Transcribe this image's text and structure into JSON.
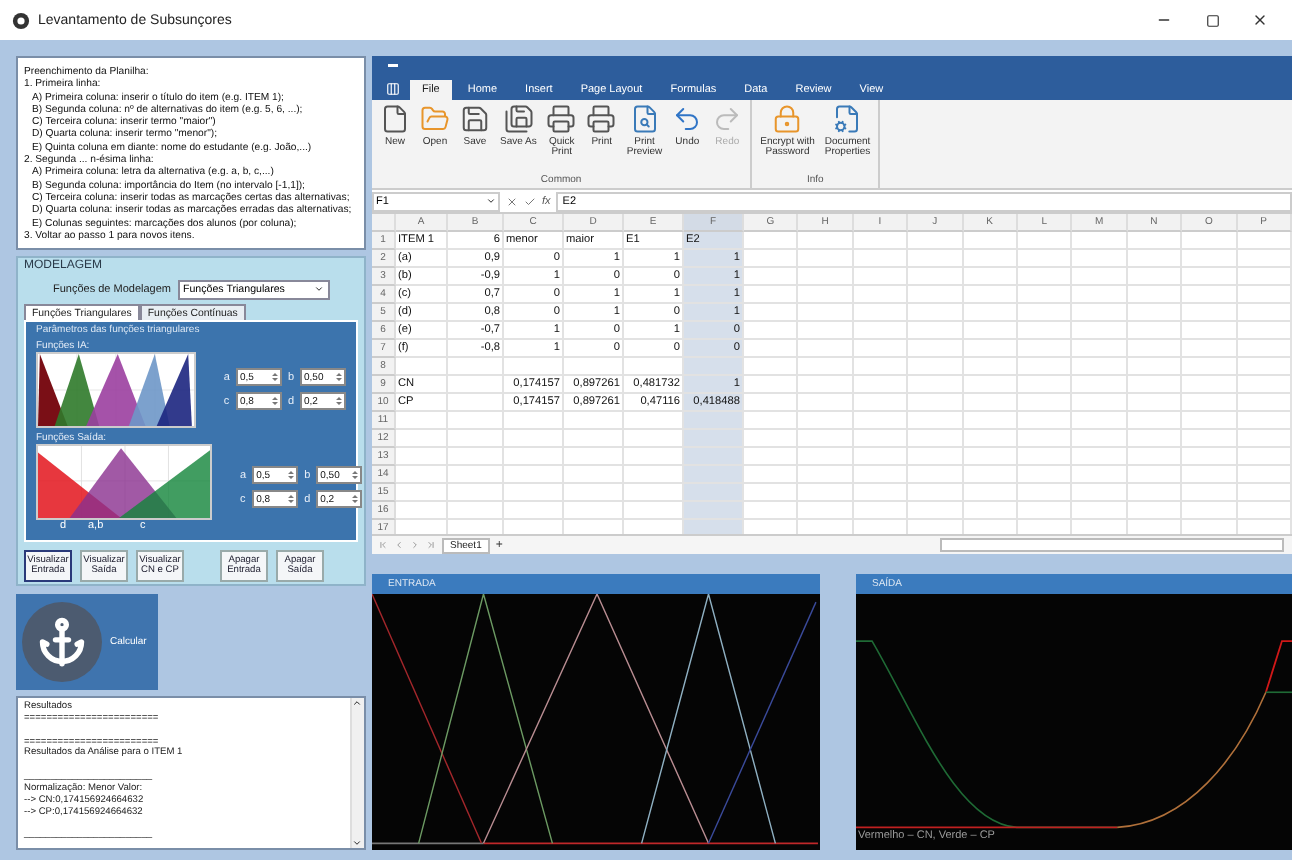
{
  "window": {
    "title": "Levantamento de Subsunçores"
  },
  "instructions": {
    "heading": "Preenchimento da Planilha:",
    "steps": [
      {
        "text": "1. Primeira linha:",
        "children": [
          {
            "text": "A) Primeira coluna: inserir o título do item (e.g. ITEM 1);"
          },
          {
            "text": "B) Segunda coluna: nº de alternativas do item (e.g. 5, 6, ...);"
          },
          {
            "text": "C) Terceira coluna: inserir termo \"maior\")"
          },
          {
            "text": "D) Quarta coluna: inserir termo \"menor\");"
          },
          {
            "text": "E) Quinta coluna em diante: nome do estudante (e.g. João,...)"
          }
        ]
      },
      {
        "text": "2. Segunda ... n-ésima linha:",
        "children": [
          {
            "text": "A) Primeira coluna: letra da alternativa (e.g. a, b, c,...)"
          },
          {
            "text": "B) Segunda coluna: importância do Item (no intervalo [-1,1]);"
          },
          {
            "text": "C) Terceira coluna: inserir todas as marcações certas das alternativas;"
          },
          {
            "text": "D) Quarta coluna: inserir todas as marcações erradas das alternativas;"
          },
          {
            "text": "E) Colunas seguintes: marcações dos alunos (por coluna);"
          }
        ]
      },
      {
        "text": "3. Voltar ao passo 1 para novos itens."
      }
    ]
  },
  "modelagem": {
    "title": "MODELAGEM",
    "function_label": "Funções de Modelagem",
    "function_value": "Funções Triangulares",
    "tabs": [
      {
        "label": "Funções Triangulares",
        "selected": true
      },
      {
        "label": "Funções Contínuas",
        "selected": false
      }
    ],
    "group_title": "Parâmetros das funções triangulares",
    "input_chart": {
      "title": "Funções IA:"
    },
    "input_params": [
      {
        "name": "a",
        "value": "0,5"
      },
      {
        "name": "b",
        "value": "0,50"
      },
      {
        "name": "c",
        "value": "0,8"
      },
      {
        "name": "d",
        "value": "0,2"
      }
    ],
    "output_chart": {
      "title": "Funções Saída:",
      "labels": [
        "d",
        "a,b",
        "c"
      ]
    },
    "output_params": [
      {
        "name": "a",
        "value": "0,5"
      },
      {
        "name": "b",
        "value": "0,50"
      },
      {
        "name": "c",
        "value": "0,8"
      },
      {
        "name": "d",
        "value": "0,2"
      }
    ],
    "buttons": [
      {
        "label": "Visualizar\nEntrada",
        "selected": true
      },
      {
        "label": "Visualizar\nSaída",
        "selected": false
      },
      {
        "label": "Visualizar\nCN e CP",
        "selected": false
      },
      {
        "label": "Apagar\nEntrada",
        "selected": false
      },
      {
        "label": "Apagar\nSaída",
        "selected": false
      }
    ]
  },
  "calculate_button": {
    "label": "Calcular"
  },
  "results": {
    "lines": [
      {
        "text": "Resultados",
        "space_before": false
      },
      {
        "text": "========================",
        "space_before": false
      },
      {
        "text": "========================",
        "space_before": true
      },
      {
        "text": "Resultados da Análise para o ITEM 1",
        "space_before": false
      },
      {
        "text": "________________________",
        "space_before": true
      },
      {
        "text": "Normalização: Menor Valor:",
        "space_before": false
      },
      {
        "text": "--> CN:0,174156924664632",
        "space_before": false
      },
      {
        "text": "--> CP:0,174156924664632",
        "space_before": false
      },
      {
        "text": "________________________",
        "space_before": true
      }
    ]
  },
  "ribbon": {
    "tabs": [
      {
        "label": "File",
        "selected": true
      },
      {
        "label": "Home",
        "selected": false
      },
      {
        "label": "Insert",
        "selected": false
      },
      {
        "label": "Page Layout",
        "selected": false
      },
      {
        "label": "Formulas",
        "selected": false
      },
      {
        "label": "Data",
        "selected": false
      },
      {
        "label": "Review",
        "selected": false
      },
      {
        "label": "View",
        "selected": false
      }
    ],
    "groups": [
      {
        "label": "Common",
        "buttons": [
          {
            "label": "New",
            "kind": "new",
            "disabled": false
          },
          {
            "label": "Open",
            "kind": "open",
            "disabled": false
          },
          {
            "label": "Save",
            "kind": "save",
            "disabled": false
          },
          {
            "label": "Save As",
            "kind": "saveas",
            "disabled": false
          },
          {
            "label": "Quick\nPrint",
            "kind": "print",
            "disabled": false
          },
          {
            "label": "Print",
            "kind": "print",
            "disabled": false
          },
          {
            "label": "Print\nPreview",
            "kind": "preview",
            "disabled": false
          },
          {
            "label": "Undo",
            "kind": "undo",
            "disabled": false
          },
          {
            "label": "Redo",
            "kind": "redo",
            "disabled": true
          }
        ]
      },
      {
        "label": "Info",
        "buttons": [
          {
            "label": "Encrypt with\nPassword",
            "kind": "lock",
            "disabled": false
          },
          {
            "label": "Document\nProperties",
            "kind": "properties",
            "disabled": false
          }
        ]
      }
    ]
  },
  "formula_bar": {
    "cell": "F1",
    "function_label": "fx",
    "value": "E2"
  },
  "sheet": {
    "columns": [
      {
        "label": "A",
        "selected": false
      },
      {
        "label": "B",
        "selected": false
      },
      {
        "label": "C",
        "selected": false
      },
      {
        "label": "D",
        "selected": false
      },
      {
        "label": "E",
        "selected": false
      },
      {
        "label": "F",
        "selected": true
      },
      {
        "label": "G",
        "selected": false
      },
      {
        "label": "H",
        "selected": false
      },
      {
        "label": "I",
        "selected": false
      },
      {
        "label": "J",
        "selected": false
      },
      {
        "label": "K",
        "selected": false
      },
      {
        "label": "L",
        "selected": false
      },
      {
        "label": "M",
        "selected": false
      },
      {
        "label": "N",
        "selected": false
      },
      {
        "label": "O",
        "selected": false
      },
      {
        "label": "P",
        "selected": false
      }
    ],
    "rows": [
      {
        "number": "1",
        "cells": [
          {
            "text": "ITEM 1",
            "numeric": false
          },
          {
            "text": "6",
            "numeric": true
          },
          {
            "text": "menor",
            "numeric": false
          },
          {
            "text": "maior",
            "numeric": false
          },
          {
            "text": "E1",
            "numeric": false
          },
          {
            "text": "E2",
            "numeric": false
          }
        ]
      },
      {
        "number": "2",
        "cells": [
          {
            "text": "(a)",
            "numeric": false
          },
          {
            "text": "0,9",
            "numeric": true
          },
          {
            "text": "0",
            "numeric": true
          },
          {
            "text": "1",
            "numeric": true
          },
          {
            "text": "1",
            "numeric": true
          },
          {
            "text": "1",
            "numeric": true
          }
        ]
      },
      {
        "number": "3",
        "cells": [
          {
            "text": "(b)",
            "numeric": false
          },
          {
            "text": "-0,9",
            "numeric": true
          },
          {
            "text": "1",
            "numeric": true
          },
          {
            "text": "0",
            "numeric": true
          },
          {
            "text": "0",
            "numeric": true
          },
          {
            "text": "1",
            "numeric": true
          }
        ]
      },
      {
        "number": "4",
        "cells": [
          {
            "text": "(c)",
            "numeric": false
          },
          {
            "text": "0,7",
            "numeric": true
          },
          {
            "text": "0",
            "numeric": true
          },
          {
            "text": "1",
            "numeric": true
          },
          {
            "text": "1",
            "numeric": true
          },
          {
            "text": "1",
            "numeric": true
          }
        ]
      },
      {
        "number": "5",
        "cells": [
          {
            "text": "(d)",
            "numeric": false
          },
          {
            "text": "0,8",
            "numeric": true
          },
          {
            "text": "0",
            "numeric": true
          },
          {
            "text": "1",
            "numeric": true
          },
          {
            "text": "0",
            "numeric": true
          },
          {
            "text": "1",
            "numeric": true
          }
        ]
      },
      {
        "number": "6",
        "cells": [
          {
            "text": "(e)",
            "numeric": false
          },
          {
            "text": "-0,7",
            "numeric": true
          },
          {
            "text": "1",
            "numeric": true
          },
          {
            "text": "0",
            "numeric": true
          },
          {
            "text": "1",
            "numeric": true
          },
          {
            "text": "0",
            "numeric": true
          }
        ]
      },
      {
        "number": "7",
        "cells": [
          {
            "text": "(f)",
            "numeric": false
          },
          {
            "text": "-0,8",
            "numeric": true
          },
          {
            "text": "1",
            "numeric": true
          },
          {
            "text": "0",
            "numeric": true
          },
          {
            "text": "0",
            "numeric": true
          },
          {
            "text": "0",
            "numeric": true
          }
        ]
      },
      {
        "number": "8"
      },
      {
        "number": "9",
        "cells": [
          {
            "text": "CN",
            "numeric": false
          },
          null,
          {
            "text": "0,174157",
            "numeric": true
          },
          {
            "text": "0,897261",
            "numeric": true
          },
          {
            "text": "0,481732",
            "numeric": true
          },
          {
            "text": "1",
            "numeric": true
          }
        ]
      },
      {
        "number": "10",
        "cells": [
          {
            "text": "CP",
            "numeric": false
          },
          null,
          {
            "text": "0,174157",
            "numeric": true
          },
          {
            "text": "0,897261",
            "numeric": true
          },
          {
            "text": "0,47116",
            "numeric": true
          },
          {
            "text": "0,418488",
            "numeric": true
          }
        ]
      },
      {
        "number": "11"
      },
      {
        "number": "12"
      },
      {
        "number": "13"
      },
      {
        "number": "14"
      },
      {
        "number": "15"
      },
      {
        "number": "16"
      },
      {
        "number": "17"
      }
    ],
    "tabs": [
      {
        "label": "Sheet1",
        "selected": true
      }
    ],
    "add_sheet": "+"
  },
  "charts": {
    "input": {
      "title": "ENTRADA"
    },
    "output": {
      "title": "SAÍDA",
      "legend": "Vermelho – CN, Verde – CP"
    }
  }
}
